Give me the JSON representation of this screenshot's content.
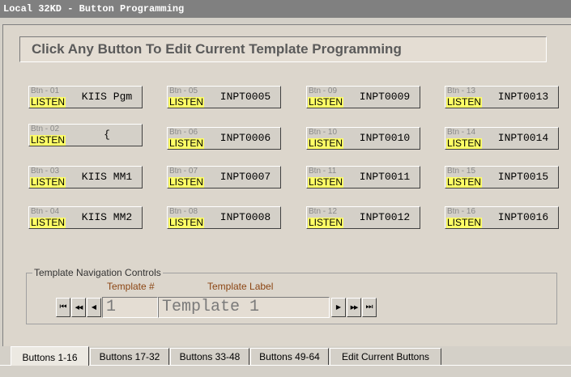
{
  "window": {
    "title": "Local 32KD - Button Programming"
  },
  "header": {
    "text": "Click Any Button To Edit Current Template Programming"
  },
  "buttons": [
    {
      "num": "Btn - 01",
      "status": "LISTEN",
      "name": "KIIS Pgm"
    },
    {
      "num": "Btn - 02",
      "status": "LISTEN",
      "name": "{"
    },
    {
      "num": "Btn - 03",
      "status": "LISTEN",
      "name": "KIIS MM1"
    },
    {
      "num": "Btn - 04",
      "status": "LISTEN",
      "name": "KIIS MM2"
    },
    {
      "num": "Btn - 05",
      "status": "LISTEN",
      "name": "INPT0005"
    },
    {
      "num": "Btn - 06",
      "status": "LISTEN",
      "name": "INPT0006"
    },
    {
      "num": "Btn - 07",
      "status": "LISTEN",
      "name": "INPT0007"
    },
    {
      "num": "Btn - 08",
      "status": "LISTEN",
      "name": "INPT0008"
    },
    {
      "num": "Btn - 09",
      "status": "LISTEN",
      "name": "INPT0009"
    },
    {
      "num": "Btn - 10",
      "status": "LISTEN",
      "name": "INPT0010"
    },
    {
      "num": "Btn - 11",
      "status": "LISTEN",
      "name": "INPT0011"
    },
    {
      "num": "Btn - 12",
      "status": "LISTEN",
      "name": "INPT0012"
    },
    {
      "num": "Btn - 13",
      "status": "LISTEN",
      "name": "INPT0013"
    },
    {
      "num": "Btn - 14",
      "status": "LISTEN",
      "name": "INPT0014"
    },
    {
      "num": "Btn - 15",
      "status": "LISTEN",
      "name": "INPT0015"
    },
    {
      "num": "Btn - 16",
      "status": "LISTEN",
      "name": "INPT0016"
    }
  ],
  "nav": {
    "legend": "Template Navigation Controls",
    "template_num_label": "Template #",
    "template_label_label": "Template Label",
    "template_num": "1",
    "template_label": "Template 1",
    "first": "⏮",
    "prev_page": "◀◀",
    "prev": "◀",
    "next": "▶",
    "next_page": "▶▶",
    "last": "⏭"
  },
  "tabs": [
    "Buttons 1-16",
    "Buttons 17-32",
    "Buttons 33-48",
    "Buttons 49-64",
    "Edit Current Buttons"
  ],
  "colors": {
    "listen_bg": "#ffff66",
    "label_brown": "#8b4513",
    "face": "#d4d0c8"
  }
}
